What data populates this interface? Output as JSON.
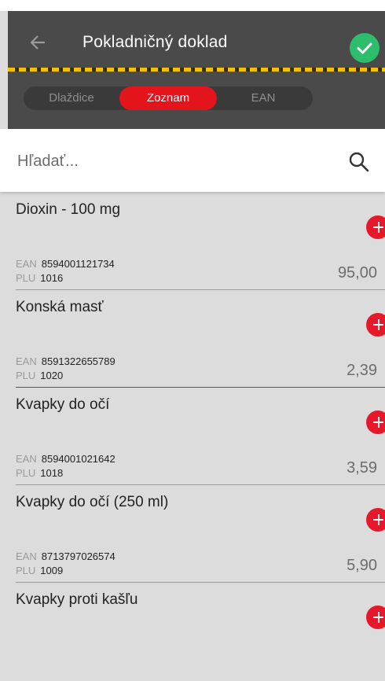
{
  "header": {
    "title": "Pokladničný doklad",
    "back_icon": "back-arrow-icon",
    "confirm_icon": "checkmark-icon",
    "accent": "#e4141d",
    "confirm_color": "#2ebd6b"
  },
  "view_tabs": [
    {
      "label": "Dlaždice",
      "active": false
    },
    {
      "label": "Zoznam",
      "active": true
    },
    {
      "label": "EAN",
      "active": false
    }
  ],
  "search": {
    "placeholder": "Hľadať...",
    "value": ""
  },
  "labels": {
    "ean": "EAN",
    "plu": "PLU"
  },
  "items": [
    {
      "name": "Dioxin - 100 mg",
      "ean": "8594001121734",
      "plu": "1016",
      "price": "95,00"
    },
    {
      "name": "Konská masť",
      "ean": "8591322655789",
      "plu": "1020",
      "price": "2,39"
    },
    {
      "name": "Kvapky do očí",
      "ean": "8594001021642",
      "plu": "1018",
      "price": "3,59"
    },
    {
      "name": "Kvapky do očí (250 ml)",
      "ean": "8713797026574",
      "plu": "1009",
      "price": "5,90"
    },
    {
      "name": "Kvapky proti kašľu",
      "ean": "",
      "plu": "",
      "price": ""
    }
  ]
}
